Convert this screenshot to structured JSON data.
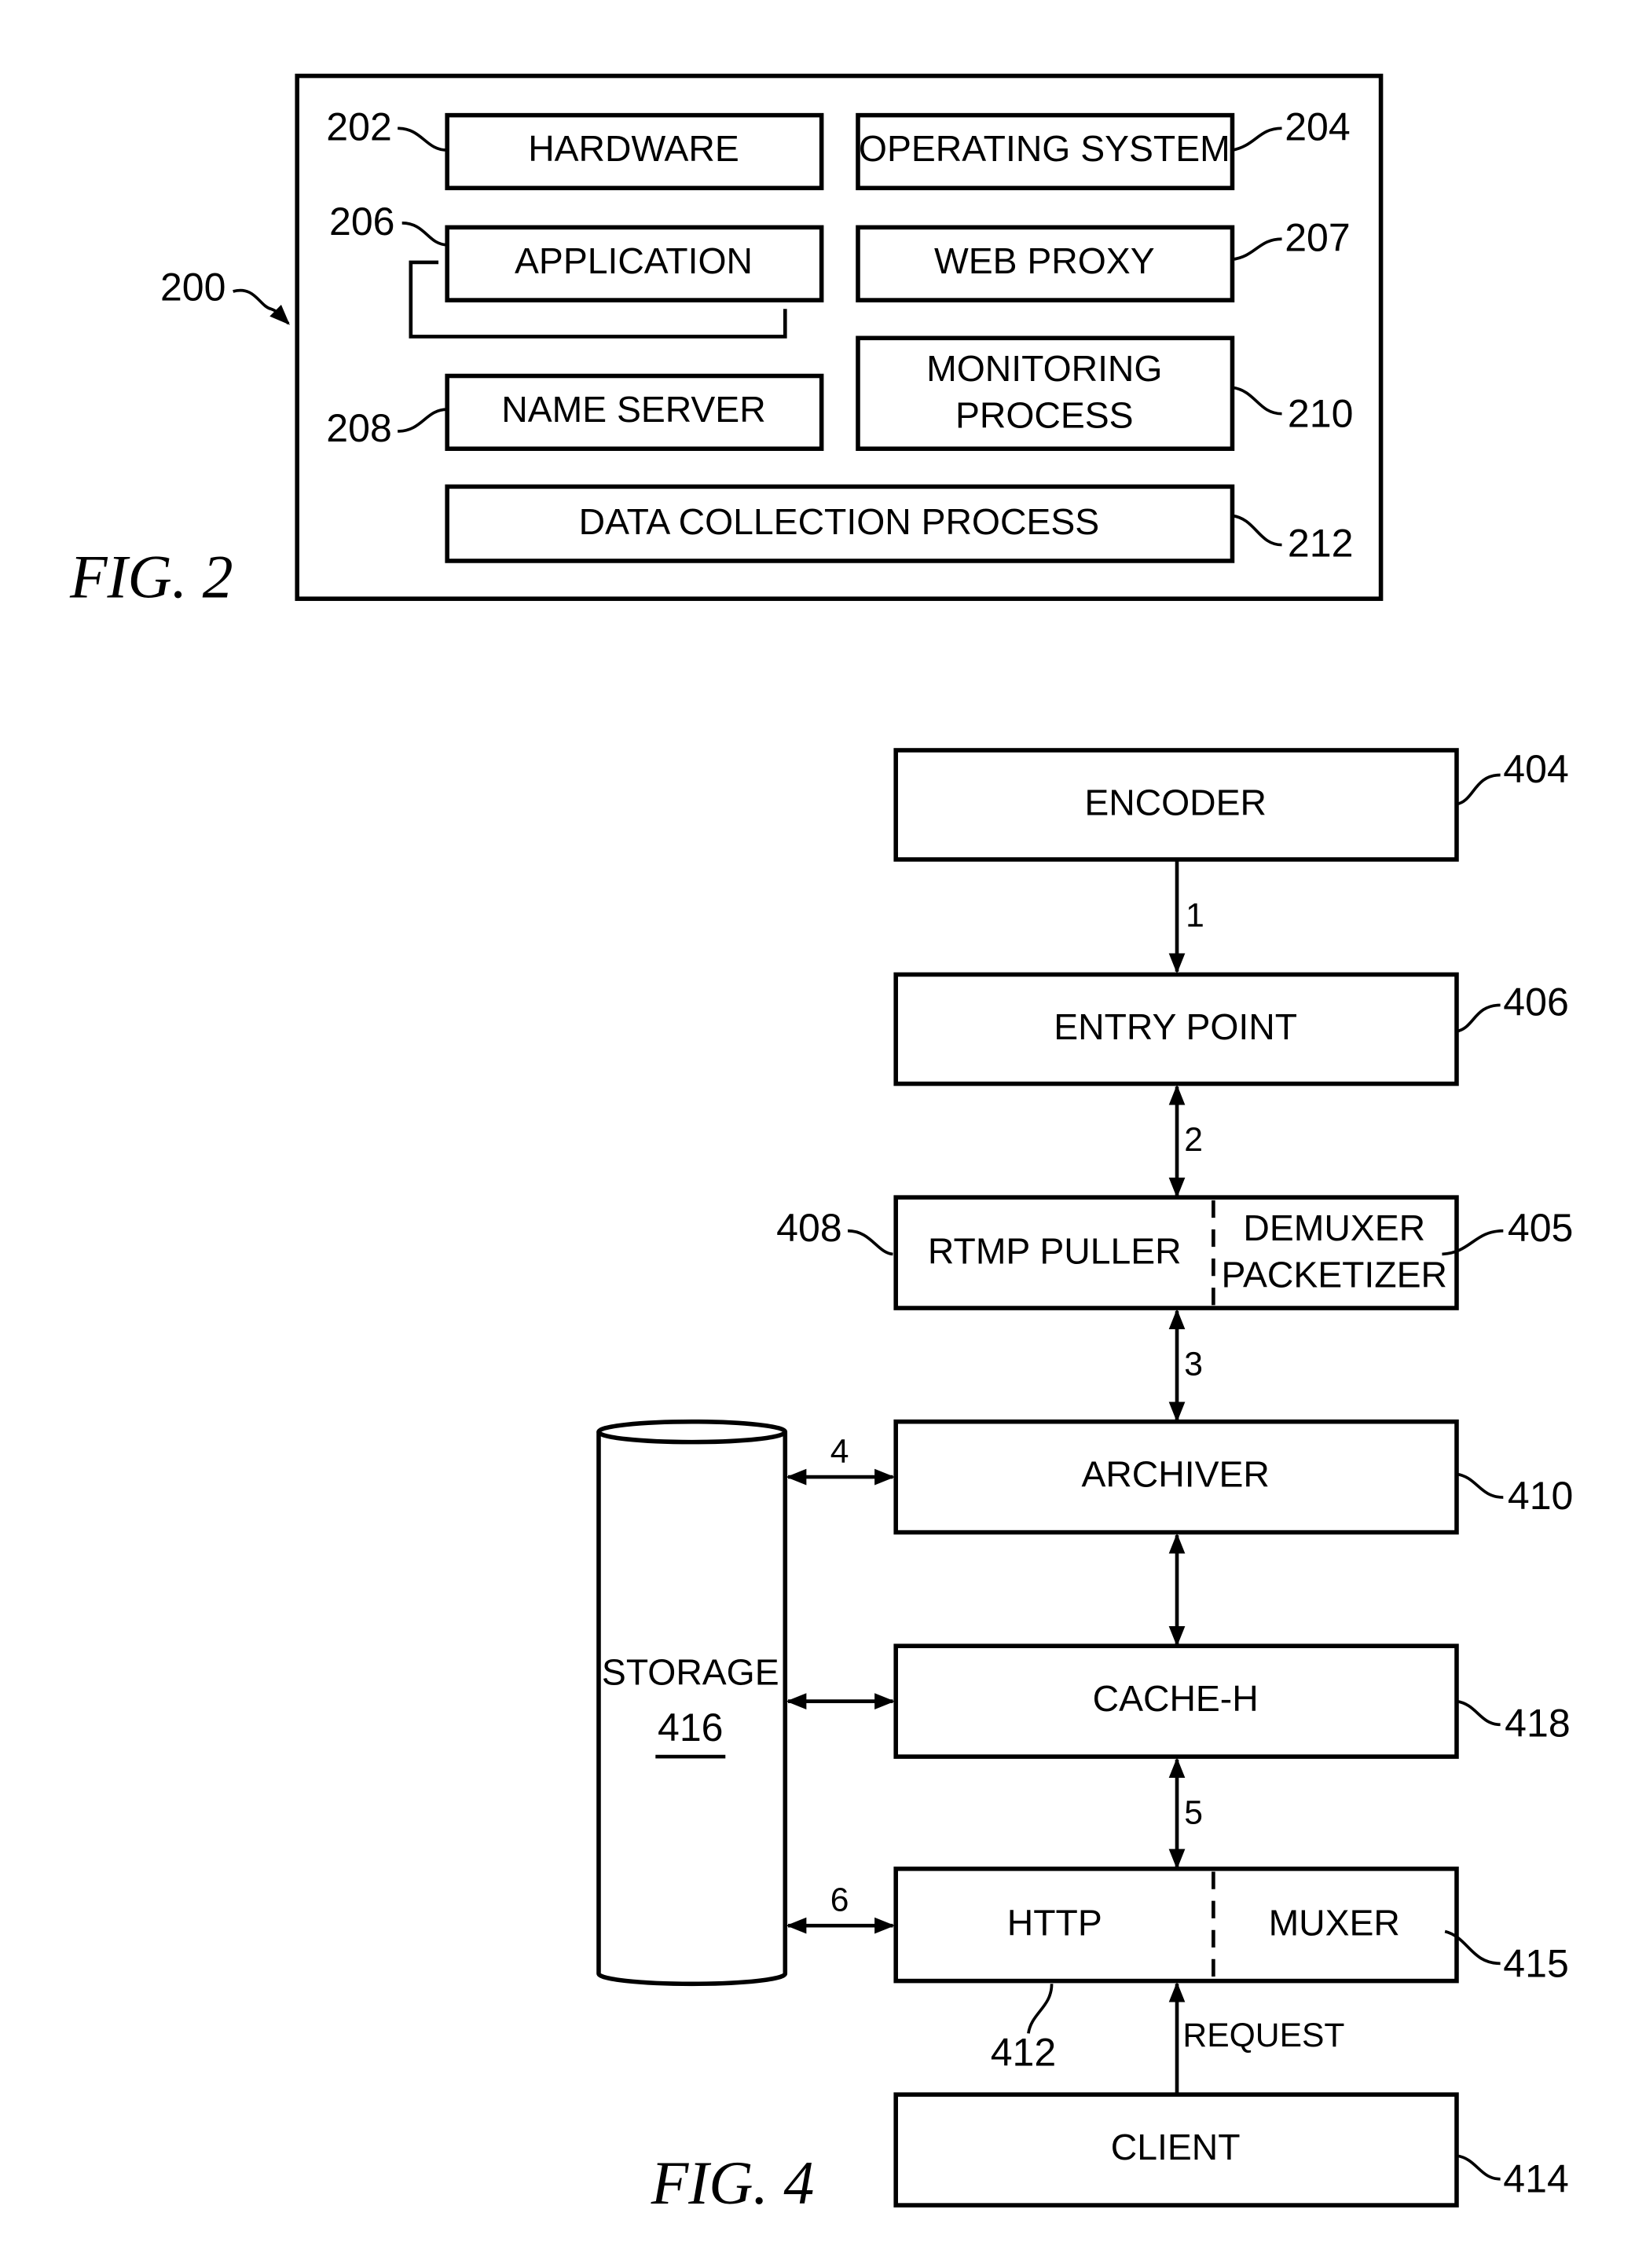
{
  "fig2": {
    "caption": "FIG. 2",
    "container_ref": "200",
    "blocks": {
      "hardware": {
        "label": "HARDWARE",
        "ref": "202"
      },
      "os": {
        "label": "OPERATING SYSTEM",
        "ref": "204"
      },
      "application": {
        "label": "APPLICATION",
        "ref": "206"
      },
      "web_proxy": {
        "label": "WEB PROXY",
        "ref": "207"
      },
      "name_server": {
        "label": "NAME SERVER",
        "ref": "208"
      },
      "monitoring": {
        "line1": "MONITORING",
        "line2": "PROCESS",
        "ref": "210"
      },
      "data_collection": {
        "label": "DATA COLLECTION PROCESS",
        "ref": "212"
      }
    }
  },
  "fig4": {
    "caption": "FIG. 4",
    "blocks": {
      "encoder": {
        "label": "ENCODER",
        "ref": "404"
      },
      "entry_point": {
        "label": "ENTRY POINT",
        "ref": "406"
      },
      "rtmp_puller": {
        "label": "RTMP PULLER",
        "ref": "408"
      },
      "demuxer": {
        "line1": "DEMUXER",
        "line2": "PACKETIZER",
        "ref": "405"
      },
      "archiver": {
        "label": "ARCHIVER",
        "ref": "410"
      },
      "cache_h": {
        "label": "CACHE-H",
        "ref": "418"
      },
      "http": {
        "label": "HTTP",
        "ref": "412"
      },
      "muxer": {
        "label": "MUXER",
        "ref": "415"
      },
      "client": {
        "label": "CLIENT",
        "ref": "414"
      },
      "storage": {
        "label": "STORAGE",
        "ref": "416"
      }
    },
    "flows": {
      "f1": "1",
      "f2": "2",
      "f3": "3",
      "f4": "4",
      "f5": "5",
      "f6": "6",
      "request": "REQUEST"
    }
  }
}
